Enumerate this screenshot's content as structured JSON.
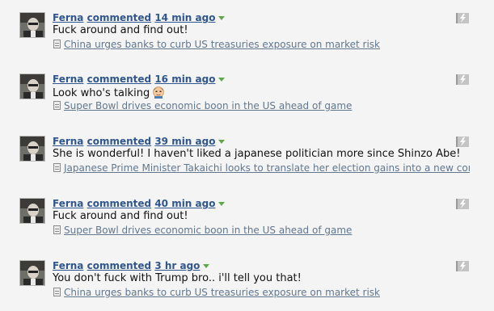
{
  "comments": [
    {
      "author": "Ferna",
      "verb": "commented",
      "time": "14 min ago",
      "text": "Fuck around and find out!",
      "article": "China urges banks to curb US treasuries exposure on market risk"
    },
    {
      "author": "Ferna",
      "verb": "commented",
      "time": "16 min ago",
      "text": "Look who's talking",
      "emoji": "man-face-emoji",
      "article": "Super Bowl drives economic boon in the US ahead of game"
    },
    {
      "author": "Ferna",
      "verb": "commented",
      "time": "39 min ago",
      "text": "She is wonderful! I haven't liked a japanese politician more since Shinzo Abe!",
      "article": "Japanese Prime Minister Takaichi looks to translate her election gains into a new conservative"
    },
    {
      "author": "Ferna",
      "verb": "commented",
      "time": "40 min ago",
      "text": "Fuck around and find out!",
      "article": "Super Bowl drives economic boon in the US ahead of game"
    },
    {
      "author": "Ferna",
      "verb": "commented",
      "time": "3 hr ago",
      "text": "You don't fuck with Trump bro.. i'll tell you that!",
      "article": "China urges banks to curb US treasuries exposure on market risk"
    }
  ],
  "colors": {
    "header": "#30568f",
    "caret": "#5fa84a",
    "link": "#61778f",
    "background": "#f4f4f4"
  }
}
